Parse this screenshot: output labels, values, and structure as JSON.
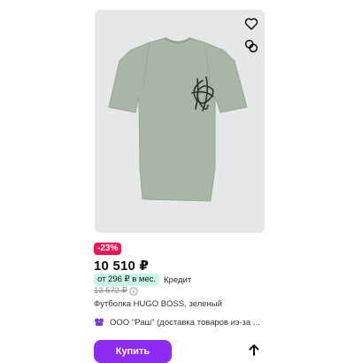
{
  "product": {
    "discount": "-23%",
    "price": "10 510 ₽",
    "installment": "от 296 ₽ в мес.",
    "credit_label": "Кредит",
    "old_price": "13 572 ₽",
    "name": "Футболка HUGO BOSS, зеленый",
    "seller": "ООО \"Раш\" (доставка товаров из-за ...",
    "buy_label": "Купить"
  },
  "icons": {
    "favorite": "heart-icon",
    "compare": "compare-icon",
    "info": "info-icon",
    "seller": "seller-logo-icon",
    "share": "share-arrow-icon"
  },
  "colors": {
    "discount_badge": "#f91155",
    "installment_chip": "#c9f7e6",
    "buy_button": "#8d2cf0",
    "tshirt": "#a8b6a5"
  }
}
